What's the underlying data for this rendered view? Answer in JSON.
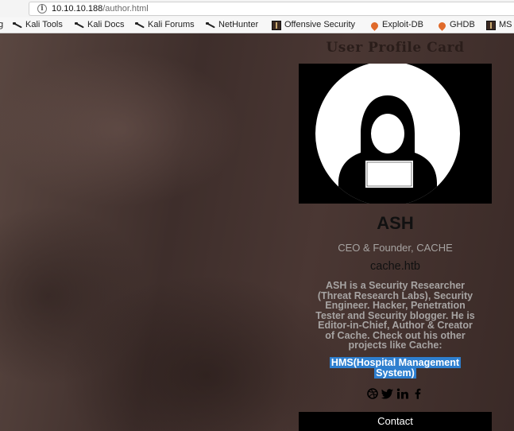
{
  "browser": {
    "url_host": "10.10.10.188",
    "url_path": "/author.html",
    "bookmarks": [
      {
        "label": "g",
        "icon": "none"
      },
      {
        "label": "Kali Tools",
        "icon": "kali-dragon-icon"
      },
      {
        "label": "Kali Docs",
        "icon": "kali-dragon-icon"
      },
      {
        "label": "Kali Forums",
        "icon": "kali-dragon-icon"
      },
      {
        "label": "NetHunter",
        "icon": "kali-dragon-icon"
      },
      {
        "label": "Offensive Security",
        "icon": "offsec-icon"
      },
      {
        "label": "Exploit-DB",
        "icon": "exploit-db-icon"
      },
      {
        "label": "GHDB",
        "icon": "exploit-db-icon"
      },
      {
        "label": "MS",
        "icon": "offsec-icon"
      }
    ]
  },
  "page": {
    "title": "User Profile Card",
    "avatar_icon": "hacker-avatar-icon",
    "name": "ASH",
    "role": "CEO & Founder, CACHE",
    "site": "cache.htb",
    "bio_lines": [
      "ASH is a Security Researcher",
      "(Threat Research Labs), Security",
      "Engineer. Hacker, Penetration",
      "Tester and Security blogger. He is",
      "Editor-in-Chief, Author & Creator",
      "of Cache. Check out his other",
      "projects like Cache:"
    ],
    "highlight_lines": [
      "HMS(Hospital Management",
      "System)"
    ],
    "highlight_color": "#2e7fcf",
    "social_icons": [
      "dribbble-icon",
      "twitter-icon",
      "linkedin-icon",
      "facebook-icon"
    ],
    "contact_label": "Contact"
  }
}
